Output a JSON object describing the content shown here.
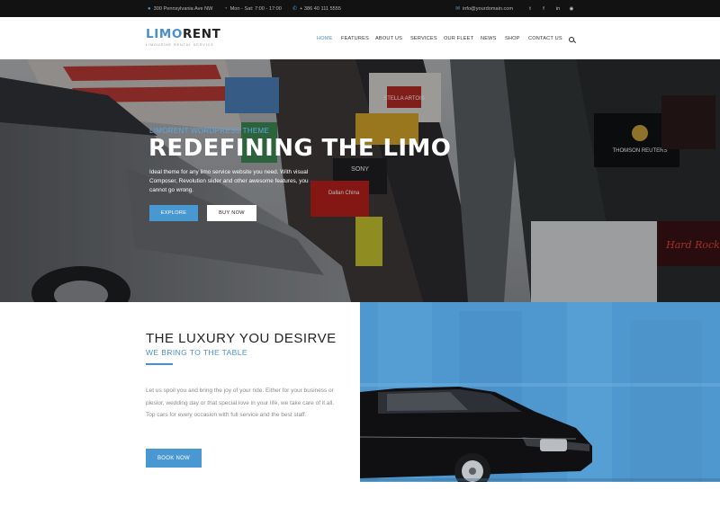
{
  "topbar": {
    "address": "300 Pennsylvania Ave NW",
    "hours": "Mon - Sat: 7:00 - 17:00",
    "phone": "+ 386 40 111 5555",
    "email": "info@yourdomain.com",
    "socials": [
      "twitter",
      "facebook",
      "linkedin",
      "instagram"
    ]
  },
  "header": {
    "logo_part1": "LIMO",
    "logo_part2": "RENT",
    "logo_tagline": "LIMOUSINE RENTAL SERVICE",
    "nav": [
      "HOME",
      "FEATURES",
      "ABOUT US",
      "SERVICES",
      "OUR FLEET",
      "NEWS",
      "SHOP",
      "CONTACT US"
    ],
    "active_nav": "HOME"
  },
  "hero": {
    "kicker": "LIMORENT WORDPRESS THEME",
    "title": "REDEFINING THE LIMO",
    "description": "Ideal theme for any limo service website you need. With visual Composer, Revolution slider and other awesome features, you cannot go wrong.",
    "explore_label": "EXPLORE",
    "buy_label": "BUY NOW",
    "billboards": [
      "STELLA ARTOIS",
      "SONY",
      "Dallan China",
      "THOMSON REUTERS",
      "Hard Rock"
    ]
  },
  "luxury": {
    "title": "THE LUXURY YOU DESIRVE",
    "subtitle": "WE BRING TO THE TABLE",
    "body": "Let us spoil you and bring the joy of your ride. Either for your business or plesior, wedding day or that special love in your life, we take care of it all. Top cars for every occasion with full service and the best staff.",
    "button_label": "BOOK NOW"
  },
  "colors": {
    "accent": "#4a98d1",
    "topbar_bg": "#121212",
    "section_blue": "#4f98cf"
  }
}
